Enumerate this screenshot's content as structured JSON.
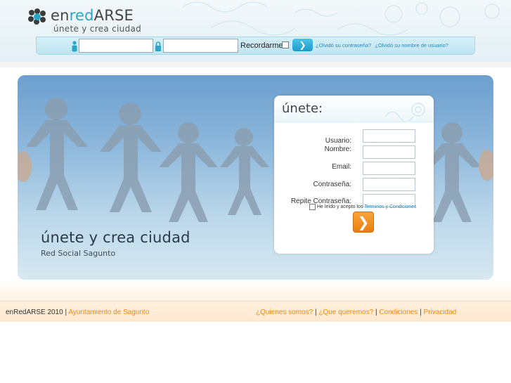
{
  "header": {
    "logo": {
      "part1": "en",
      "part2": "red",
      "part3": "ARSE",
      "tagline": "únete y crea ciudad"
    },
    "login_bar": {
      "username_placeholder": "",
      "password_placeholder": "",
      "remember_label": "Recordarme",
      "submit_label": "❯",
      "forgot_password": "¿Olvidó su contraseña?",
      "forgot_username": "¿Olvidó su nombre de usuario?"
    }
  },
  "hero": {
    "title": "únete y crea ciudad",
    "subtitle": "Red Social Sagunto"
  },
  "register": {
    "title": "únete:",
    "fields": [
      {
        "label": "Usuario:"
      },
      {
        "label": "Nombre:"
      },
      {
        "label": "Email:"
      },
      {
        "label": "Contraseña:"
      },
      {
        "label": "Repite Contraseña:"
      }
    ],
    "terms_prefix": "He leído y acepto los",
    "terms_link": "Terminos y Condiciones",
    "submit_label": "❯"
  },
  "footer": {
    "copyright": "enRedARSE 2010",
    "sep": "|",
    "ayuntamiento": "Ayuntamiento de Sagunto",
    "links": [
      "¿Quienes somos?",
      "¿Que queremos?",
      "Condiciones",
      "Privacidad"
    ]
  },
  "colors": {
    "accent_blue": "#2aa6c8",
    "accent_orange": "#f08a12",
    "login_bar_bg": "#c9eaf4"
  },
  "icons": {
    "user": "user-icon",
    "lock": "lock-icon",
    "arrow": "arrow-right-icon",
    "logo": "logo-mark-icon"
  }
}
